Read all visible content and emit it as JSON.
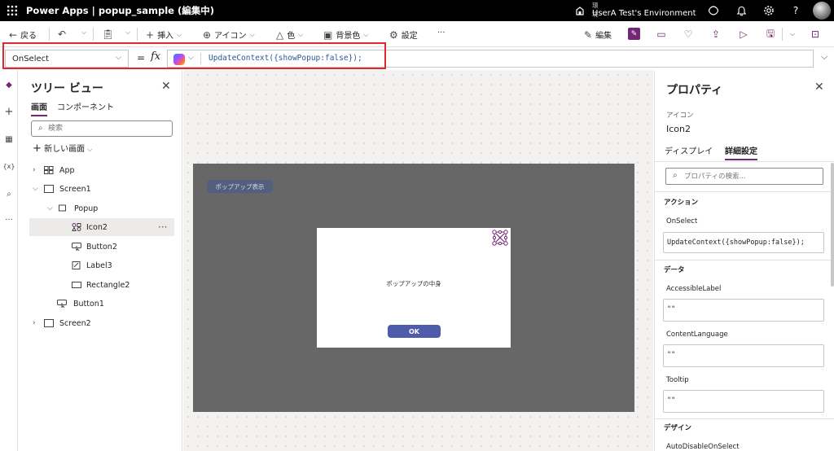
{
  "topbar": {
    "app_title": "Power Apps  |  popup_sample (編集中)",
    "environment_label": "環境",
    "environment_name": "UserA Test's Environment",
    "help": "?"
  },
  "commandbar": {
    "back": "戻る",
    "insert": "挿入",
    "icon": "アイコン",
    "color": "色",
    "background": "背景色",
    "settings": "設定",
    "more": "···",
    "edit": "編集"
  },
  "formula_bar": {
    "property": "OnSelect",
    "equals": "=",
    "fx": "fx",
    "formula": "UpdateContext({showPopup:false});"
  },
  "tree_view": {
    "title": "ツリー ビュー",
    "tabs": [
      "画面",
      "コンポーネント"
    ],
    "search_placeholder": "検索",
    "new_screen": "新しい画面",
    "items": [
      {
        "label": "App"
      },
      {
        "label": "Screen1"
      },
      {
        "label": "Popup"
      },
      {
        "label": "Icon2"
      },
      {
        "label": "Button2"
      },
      {
        "label": "Label3"
      },
      {
        "label": "Rectangle2"
      },
      {
        "label": "Button1"
      },
      {
        "label": "Screen2"
      }
    ]
  },
  "canvas": {
    "popup_button": "ポップアップ表示",
    "popup_text": "ポップアップの中身",
    "ok_button": "OK"
  },
  "properties": {
    "title": "プロパティ",
    "type": "アイコン",
    "name": "Icon2",
    "tabs": [
      "ディスプレイ",
      "詳細設定"
    ],
    "search_placeholder": "プロパティの検索...",
    "sections": {
      "action": "アクション",
      "data": "データ",
      "design": "デザイン"
    },
    "fields": [
      {
        "label": "OnSelect",
        "value": "UpdateContext({showPopup:false});"
      },
      {
        "label": "AccessibleLabel",
        "value": "\"\""
      },
      {
        "label": "ContentLanguage",
        "value": "\"\""
      },
      {
        "label": "Tooltip",
        "value": "\"\""
      },
      {
        "label": "AutoDisableOnSelect"
      }
    ]
  },
  "colors": {
    "accent": "#742774",
    "highlight_border": "#e0282e",
    "ok_button": "#4f5bab",
    "screen_bg": "#676767"
  }
}
